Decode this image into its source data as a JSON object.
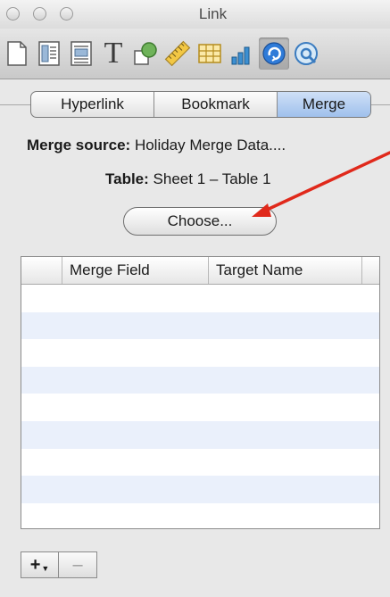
{
  "window": {
    "title": "Link"
  },
  "toolbar": {
    "items": [
      {
        "name": "document-icon"
      },
      {
        "name": "layout-icon"
      },
      {
        "name": "wrap-icon"
      },
      {
        "name": "text-icon",
        "glyph": "T"
      },
      {
        "name": "graphic-icon"
      },
      {
        "name": "metrics-icon"
      },
      {
        "name": "table-icon"
      },
      {
        "name": "chart-icon"
      },
      {
        "name": "link-icon",
        "active": true
      },
      {
        "name": "quicktime-icon"
      }
    ]
  },
  "segmented": {
    "hyperlink": "Hyperlink",
    "bookmark": "Bookmark",
    "merge": "Merge",
    "selected": "Merge"
  },
  "merge_source": {
    "label": "Merge source:",
    "value": "Holiday Merge Data...."
  },
  "table_info": {
    "label": "Table:",
    "value": "Sheet 1 – Table 1"
  },
  "choose_button": {
    "label": "Choose..."
  },
  "fields_table": {
    "columns": [
      "Merge Field",
      "Target Name"
    ],
    "rows": []
  },
  "bottom": {
    "add": "+",
    "remove": "–"
  },
  "colors": {
    "segment_selected": "#9fc0ec",
    "row_alt": "#eaf0fb",
    "annotation_arrow": "#e0291b",
    "link_icon": "#2f7bd8"
  }
}
